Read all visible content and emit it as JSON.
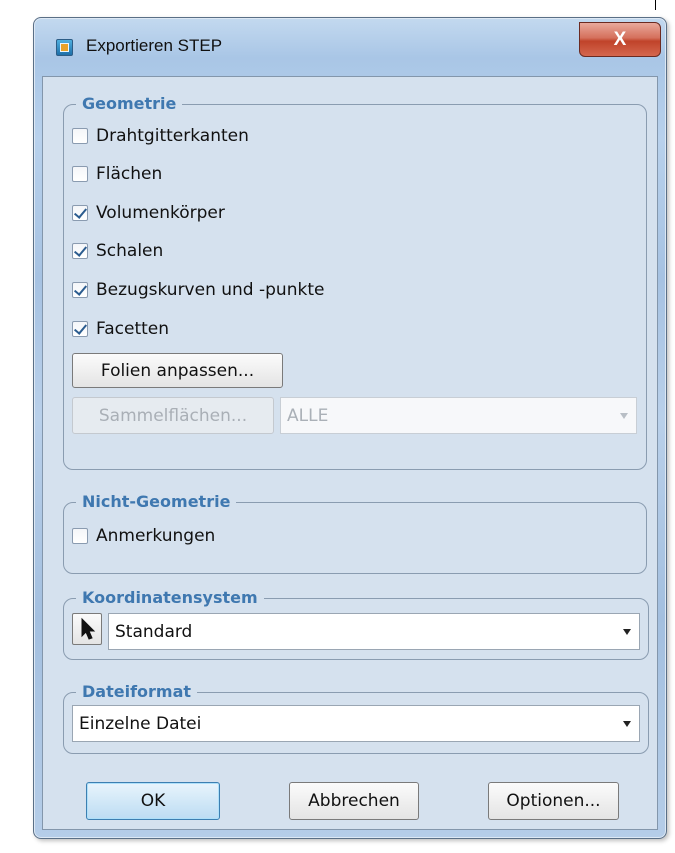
{
  "window": {
    "title": "Exportieren STEP",
    "close_label": "X"
  },
  "geometry": {
    "title": "Geometrie",
    "options": [
      {
        "label": "Drahtgitterkanten",
        "checked": false
      },
      {
        "label": "Flächen",
        "checked": false
      },
      {
        "label": "Volumenkörper",
        "checked": true
      },
      {
        "label": "Schalen",
        "checked": true
      },
      {
        "label": "Bezugskurven und -punkte",
        "checked": true
      },
      {
        "label": "Facetten",
        "checked": true
      }
    ],
    "layers_button": "Folien anpassen...",
    "quilts_button": "Sammelflächen...",
    "quilts_select": "ALLE"
  },
  "non_geometry": {
    "title": "Nicht-Geometrie",
    "annotations": {
      "label": "Anmerkungen",
      "checked": false
    }
  },
  "coordinate_system": {
    "title": "Koordinatensystem",
    "value": "Standard"
  },
  "file_format": {
    "title": "Dateiformat",
    "value": "Einzelne Datei"
  },
  "footer": {
    "ok": "OK",
    "cancel": "Abbrechen",
    "options": "Optionen..."
  }
}
